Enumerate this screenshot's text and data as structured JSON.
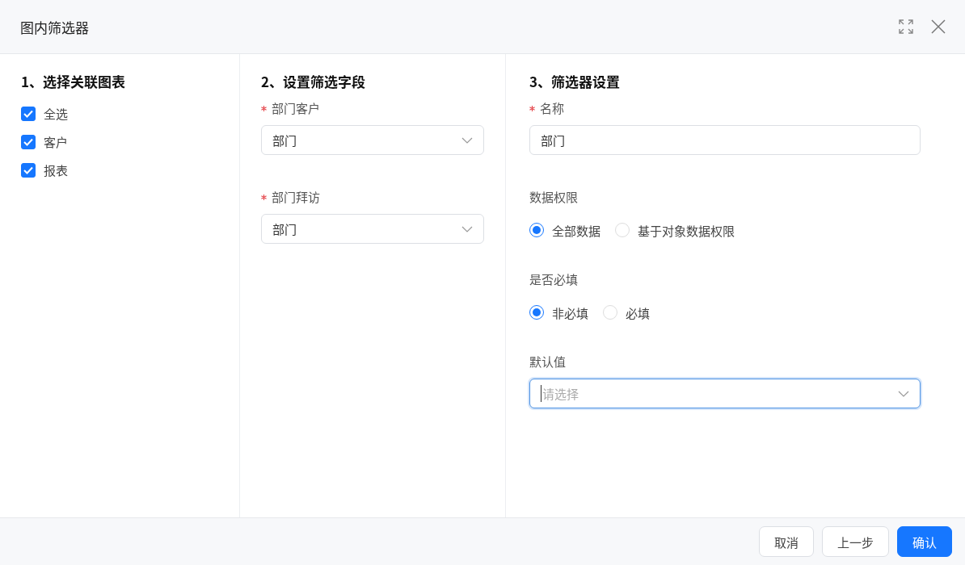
{
  "dialog": {
    "title": "图内筛选器"
  },
  "sections": [
    {
      "title": "1、选择关联图表",
      "kind": "checklist",
      "items": [
        {
          "label": "全选",
          "checked": true
        },
        {
          "label": "客户",
          "checked": true
        },
        {
          "label": "报表",
          "checked": true
        }
      ]
    },
    {
      "title": "2、设置筛选字段",
      "kind": "form",
      "fields": [
        {
          "kind": "select",
          "label": "部门客户",
          "required": true,
          "value": "部门",
          "focused": false
        },
        {
          "kind": "select",
          "label": "部门拜访",
          "required": true,
          "value": "部门",
          "focused": false
        }
      ]
    },
    {
      "title": "3、筛选器设置",
      "kind": "form",
      "fields": [
        {
          "kind": "text",
          "label": "名称",
          "required": true,
          "value": "部门",
          "focused": false
        },
        {
          "kind": "radio",
          "label": "数据权限",
          "required": false,
          "options": [
            {
              "label": "全部数据",
              "selected": true
            },
            {
              "label": "基于对象数据权限",
              "selected": false
            }
          ]
        },
        {
          "kind": "radio",
          "label": "是否必填",
          "required": false,
          "options": [
            {
              "label": "非必填",
              "selected": true
            },
            {
              "label": "必填",
              "selected": false
            }
          ]
        },
        {
          "kind": "select",
          "label": "默认值",
          "required": false,
          "placeholder": "请选择",
          "focused": true
        }
      ]
    }
  ],
  "buttons": [
    {
      "label": "取消",
      "kind": "default"
    },
    {
      "label": "上一步",
      "kind": "default"
    },
    {
      "label": "确认",
      "kind": "primary"
    }
  ]
}
